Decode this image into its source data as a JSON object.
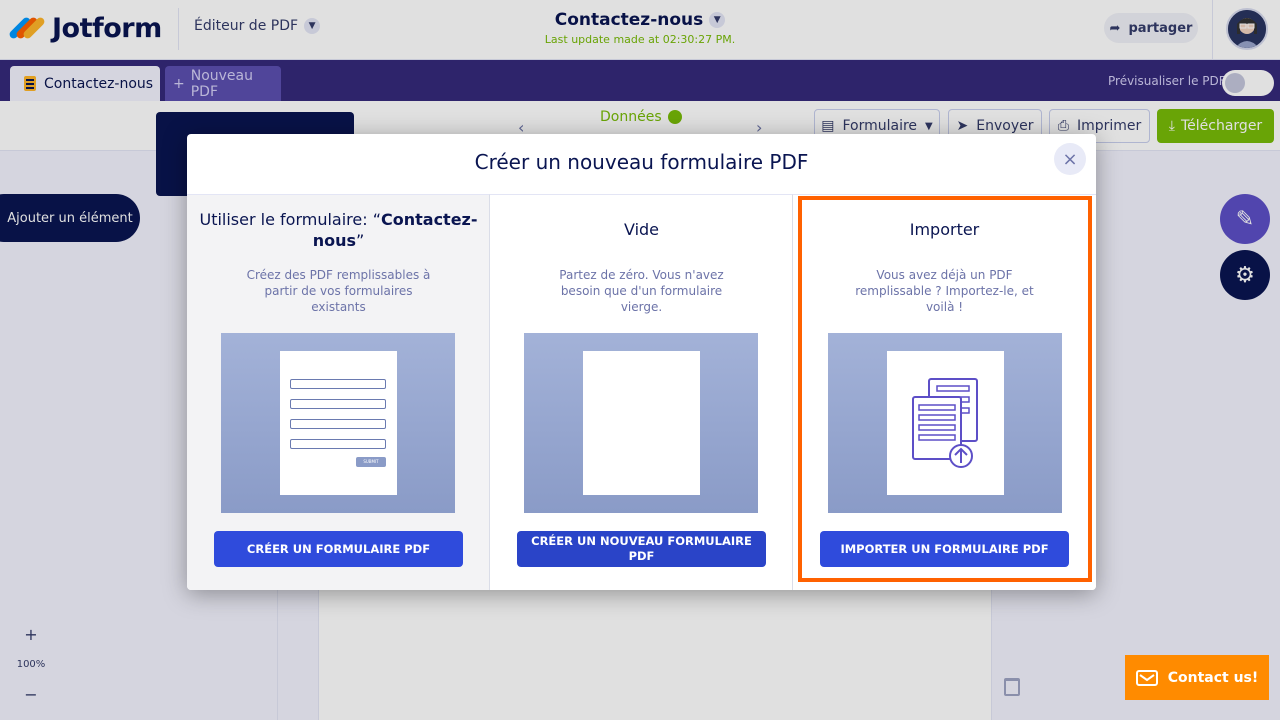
{
  "header": {
    "logo_text": "Jotform",
    "editor_switch": "Éditeur de PDF",
    "doc_title": "Contactez-nous",
    "last_update": "Last update made at 02:30:27 PM.",
    "share_label": "partager"
  },
  "tabs": {
    "active_label": "Contactez-nous",
    "new_label": "Nouveau PDF",
    "preview_label": "Prévisualiser le PDF"
  },
  "toolbar": {
    "donnees_label": "Données",
    "formulaire_label": "Formulaire",
    "envoyer_label": "Envoyer",
    "imprimer_label": "Imprimer",
    "telecharger_label": "Télécharger"
  },
  "sidebar": {
    "add_element_label": "Ajouter un élément",
    "zoom_in": "+",
    "zoom_level": "100%",
    "zoom_out": "−"
  },
  "contact_label": "Contact us!",
  "modal": {
    "title": "Créer un nouveau formulaire PDF",
    "close_icon": "×",
    "options": [
      {
        "title_prefix": "Utiliser le formulaire: “",
        "title_bold": "Contactez-nous",
        "title_suffix": "”",
        "description": "Créez des PDF remplissables à partir de vos formulaires existants",
        "button": "CRÉER UN FORMULAIRE PDF",
        "submit_mini": "SUBMIT"
      },
      {
        "title": "Vide",
        "description": "Partez de zéro. Vous n'avez besoin que d'un formulaire vierge.",
        "button": "CRÉER UN NOUVEAU FORMULAIRE PDF"
      },
      {
        "title": "Importer",
        "description": "Vous avez déjà un PDF remplissable ? Importez-le, et voilà !",
        "button": "IMPORTER UN FORMULAIRE PDF"
      }
    ]
  },
  "colors": {
    "brand_navy": "#0a1551",
    "tab_purple": "#35297a",
    "update_green": "#78bb07",
    "button_blue": "#2f4bdc",
    "highlight_orange": "#ff6100",
    "contact_orange": "#ff8b00"
  }
}
